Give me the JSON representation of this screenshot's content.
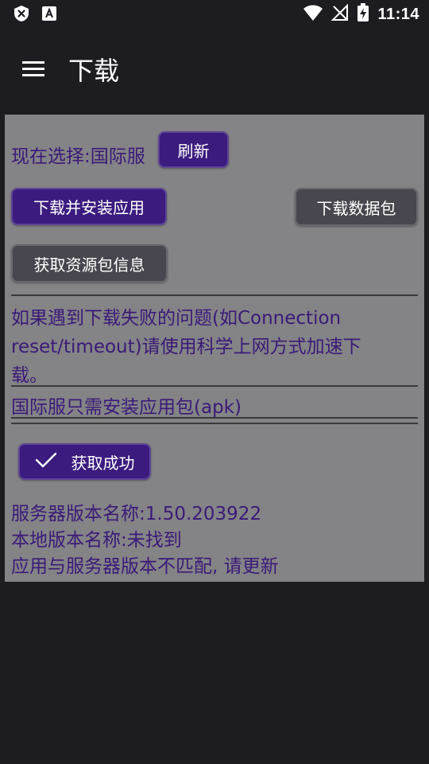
{
  "status_bar": {
    "time": "11:14",
    "icons": [
      "close-shield-icon",
      "a-badge-icon",
      "wifi-icon",
      "no-signal-icon",
      "battery-charging-icon"
    ]
  },
  "app_bar": {
    "title": "下载",
    "menu_icon": "menu-icon"
  },
  "panel": {
    "current_selection": "现在选择:国际服",
    "refresh_label": "刷新",
    "download_install_label": "下载并安装应用",
    "download_data_label": "下载数据包",
    "get_resource_info_label": "获取资源包信息",
    "notice_line1": "如果遇到下载失败的问题(如Connection",
    "notice_line2": "reset/timeout)请使用科学上网方式加速下",
    "notice_line3": "载。",
    "apk_notice": "国际服只需安装应用包(apk)",
    "success_label": "获取成功",
    "server_version": "服务器版本名称:1.50.203922",
    "local_version": "本地版本名称:未找到",
    "mismatch_notice": "应用与服务器版本不匹配, 请更新"
  },
  "colors": {
    "background": "#1d1c21",
    "panel": "#848386",
    "accent_purple": "#3b1b7e",
    "button_gray": "#48464e",
    "text_purple": "#3a1a78"
  }
}
